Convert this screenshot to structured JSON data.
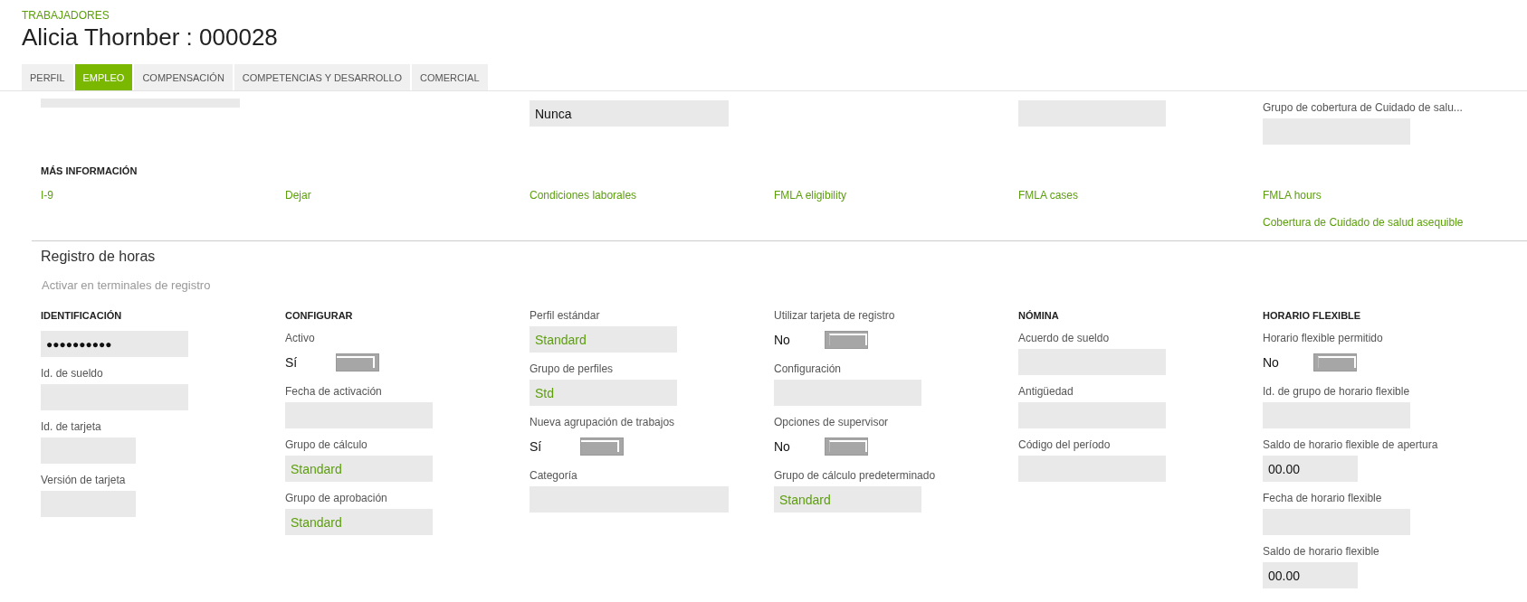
{
  "breadcrumb": "TRABAJADORES",
  "title": "Alicia Thornber : 000028",
  "tabs": [
    {
      "label": "PERFIL",
      "selected": false
    },
    {
      "label": "EMPLEO",
      "selected": true
    },
    {
      "label": "COMPENSACIÓN",
      "selected": false
    },
    {
      "label": "COMPETENCIAS Y DESARROLLO",
      "selected": false
    },
    {
      "label": "COMERCIAL",
      "selected": false
    }
  ],
  "upper_fields": [
    {
      "kind": "cut-field"
    },
    {
      "kind": "none"
    },
    {
      "kind": "long-field",
      "value": "Nunca"
    },
    {
      "kind": "none"
    },
    {
      "kind": "field"
    },
    {
      "kind": "field",
      "label": "Grupo de cobertura de Cuidado de salu..."
    }
  ],
  "more_info": {
    "heading": "MÁS INFORMACIÓN",
    "columns": [
      {
        "links": [
          "I-9"
        ]
      },
      {
        "links": [
          "Dejar"
        ]
      },
      {
        "links": [
          "Condiciones laborales"
        ]
      },
      {
        "links": [
          "FMLA eligibility"
        ]
      },
      {
        "links": [
          "FMLA cases"
        ]
      },
      {
        "links": [
          "FMLA hours",
          "Cobertura de Cuidado de salud asequible"
        ]
      }
    ]
  },
  "time_registration": {
    "title": "Registro de horas",
    "activate_link": "Activar en terminales de registro",
    "columns": [
      {
        "heading": "IDENTIFICACIÓN",
        "items": [
          {
            "kind": "password",
            "value": "●●●●●●●●●●"
          },
          {
            "kind": "field",
            "label": "Id. de sueldo"
          },
          {
            "kind": "short-field",
            "label": "Id. de tarjeta"
          },
          {
            "kind": "short-field",
            "label": "Versión de tarjeta"
          }
        ]
      },
      {
        "heading": "CONFIGURAR",
        "items": [
          {
            "kind": "toggle",
            "label": "Activo",
            "value": "Sí",
            "on": true
          },
          {
            "kind": "field",
            "label": "Fecha de activación"
          },
          {
            "kind": "lookup",
            "label": "Grupo de cálculo",
            "value": "Standard"
          },
          {
            "kind": "lookup",
            "label": "Grupo de aprobación",
            "value": "Standard"
          }
        ]
      },
      {
        "items": [
          {
            "kind": "lookup",
            "label": "Perfil estándar",
            "value": "Standard"
          },
          {
            "kind": "lookup",
            "label": "Grupo de perfiles",
            "value": "Std"
          },
          {
            "kind": "toggle",
            "label": "Nueva agrupación de trabajos",
            "value": "Sí",
            "on": true
          },
          {
            "kind": "long-field",
            "label": "Categoría"
          }
        ]
      },
      {
        "items": [
          {
            "kind": "toggle",
            "label": "Utilizar tarjeta de registro",
            "value": "No",
            "on": false
          },
          {
            "kind": "field",
            "label": "Configuración"
          },
          {
            "kind": "toggle",
            "label": "Opciones de supervisor",
            "value": "No",
            "on": false
          },
          {
            "kind": "lookup",
            "label": "Grupo de cálculo predeterminado",
            "value": "Standard"
          }
        ]
      },
      {
        "heading": "NÓMINA",
        "items": [
          {
            "kind": "field",
            "label": "Acuerdo de sueldo"
          },
          {
            "kind": "field",
            "label": "Antigüedad"
          },
          {
            "kind": "field",
            "label": "Código del período"
          }
        ]
      },
      {
        "heading": "HORARIO FLEXIBLE",
        "items": [
          {
            "kind": "toggle",
            "label": "Horario flexible permitido",
            "value": "No",
            "on": false
          },
          {
            "kind": "field",
            "label": "Id. de grupo de horario flexible"
          },
          {
            "kind": "short-field",
            "label": "Saldo de horario flexible de apertura",
            "value": "00.00"
          },
          {
            "kind": "field",
            "label": "Fecha de horario flexible"
          },
          {
            "kind": "short-field",
            "label": "Saldo de horario flexible",
            "value": "00.00"
          }
        ]
      }
    ]
  }
}
